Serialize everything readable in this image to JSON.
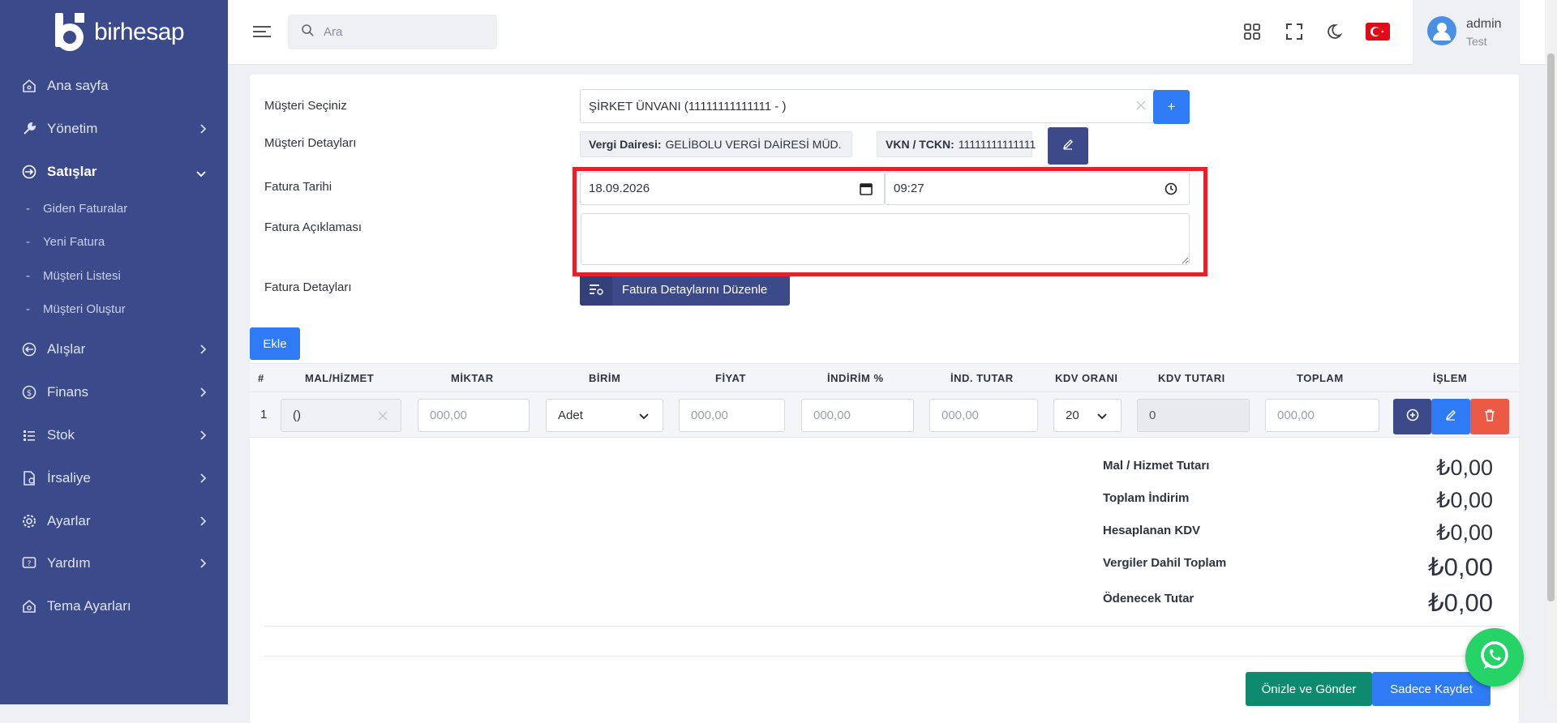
{
  "app": {
    "logo_text": "birhesap"
  },
  "sidebar": {
    "items": [
      {
        "label": "Ana sayfa",
        "icon": "home-icon"
      },
      {
        "label": "Yönetim",
        "icon": "wrench-icon"
      },
      {
        "label": "Satışlar",
        "icon": "arrow-circle-icon"
      },
      {
        "label": "Alışlar",
        "icon": "arrow-circle-icon"
      },
      {
        "label": "Finans",
        "icon": "dollar-icon"
      },
      {
        "label": "Stok",
        "icon": "list-icon"
      },
      {
        "label": "İrsaliye",
        "icon": "document-icon"
      },
      {
        "label": "Ayarlar",
        "icon": "gear-icon"
      },
      {
        "label": "Yardım",
        "icon": "help-icon"
      },
      {
        "label": "Tema Ayarları",
        "icon": "home-gear-icon"
      }
    ],
    "sub_items": [
      "Giden Faturalar",
      "Yeni Fatura",
      "Müşteri Listesi",
      "Müşteri Oluştur"
    ]
  },
  "topbar": {
    "search_placeholder": "Ara",
    "user_name": "admin",
    "user_role": "Test"
  },
  "form": {
    "customer_label": "Müşteri Seçiniz",
    "customer_value": "ŞİRKET ÜNVANI (11111111111111 - )",
    "add_customer_label": "+",
    "details_label": "Müşteri Detayları",
    "tax_office_key": "Vergi Dairesi:",
    "tax_office_value": "GELİBOLU VERGİ DAİRESİ MÜD.",
    "vkn_key": "VKN / TCKN:",
    "vkn_value": "11111111111111",
    "date_label": "Fatura Tarihi",
    "date_value": "18.09.2026",
    "time_value": "09:27",
    "description_label": "Fatura Açıklaması",
    "invoice_details_label": "Fatura Detayları",
    "invoice_details_button": "Fatura Detaylarını Düzenle",
    "add_button": "Ekle"
  },
  "table": {
    "headers": [
      "#",
      "MAL/HİZMET",
      "MİKTAR",
      "BİRİM",
      "FİYAT",
      "İNDİRİM %",
      "İND. TUTAR",
      "KDV ORANI",
      "KDV TUTARI",
      "TOPLAM",
      "İŞLEM"
    ],
    "row": {
      "index": "1",
      "product": "()",
      "quantity_placeholder": "000,00",
      "unit": "Adet",
      "price_placeholder": "000,00",
      "discount_pct_placeholder": "000,00",
      "discount_amount_placeholder": "000,00",
      "vat_rate": "20",
      "vat_amount": "0",
      "total_placeholder": "000,00"
    }
  },
  "summary": {
    "items": [
      {
        "label": "Mal / Hizmet Tutarı",
        "value": "₺0,00"
      },
      {
        "label": "Toplam İndirim",
        "value": "₺0,00"
      },
      {
        "label": "Hesaplanan KDV",
        "value": "₺0,00"
      },
      {
        "label": "Vergiler Dahil Toplam",
        "value": "₺0,00"
      },
      {
        "label": "Ödenecek Tutar",
        "value": "₺0,00"
      }
    ]
  },
  "actions": {
    "preview_send": "Önizle ve Gönder",
    "save_only": "Sadece Kaydet"
  },
  "colors": {
    "sidebar": "#3b4a8a",
    "primary": "#2f7bf6",
    "navy": "#3d4a8a",
    "danger": "#ec5a46",
    "success": "#0e8a6e",
    "highlight": "#e8202a"
  }
}
